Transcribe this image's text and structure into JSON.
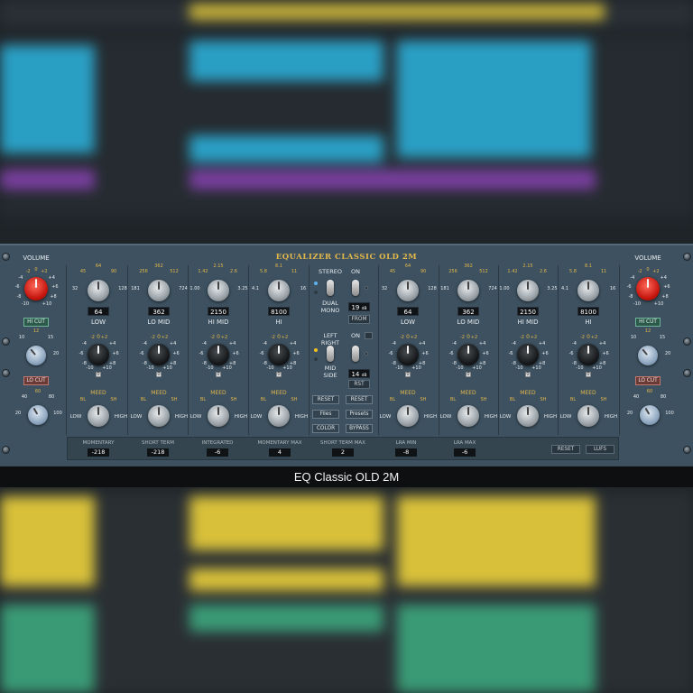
{
  "window": {
    "plugin_name": "EQUALIZER CLASSIC OLD 2M",
    "footer_title": "EQ Classic OLD 2M"
  },
  "channels": [
    {
      "volume_label": "VOLUME",
      "volume_ticks": [
        "-2",
        "0",
        "+2",
        "-4",
        "+4",
        "-6",
        "+6",
        "-8",
        "+8",
        "-10",
        "+10"
      ],
      "hicut_label": "HI CUT",
      "hicut_ticks": [
        "10",
        "12",
        "15",
        "20"
      ],
      "locut_label": "LO CUT",
      "locut_ticks": [
        "40",
        "60",
        "80",
        "20",
        "100"
      ],
      "bands": [
        {
          "label": "LOW",
          "freq": "64",
          "ticks": [
            "45",
            "64",
            "90",
            "32",
            "128"
          ],
          "meed_left": "BL",
          "meed_right": "SH"
        },
        {
          "label": "LO MID",
          "freq": "362",
          "ticks": [
            "256",
            "362",
            "512",
            "181",
            "724"
          ],
          "meed_left": "BL",
          "meed_right": "SH"
        },
        {
          "label": "HI MID",
          "freq": "2150",
          "ticks": [
            "1.42",
            "2.15",
            "2.6",
            "1.00",
            "3.25"
          ],
          "meed_left": "BL",
          "meed_right": "SH"
        },
        {
          "label": "HI",
          "freq": "8100",
          "ticks": [
            "5.8",
            "8.1",
            "11",
            "4.1",
            "16"
          ],
          "meed_left": "BL",
          "meed_right": "SH"
        }
      ]
    },
    {
      "volume_label": "VOLUME",
      "volume_ticks": [
        "-2",
        "0",
        "+2",
        "-4",
        "+4",
        "-6",
        "+6",
        "-8",
        "+8",
        "-10",
        "+10"
      ],
      "hicut_label": "HI CUT",
      "hicut_ticks": [
        "10",
        "12",
        "15",
        "20"
      ],
      "locut_label": "LO CUT",
      "locut_ticks": [
        "40",
        "60",
        "80",
        "20",
        "100"
      ],
      "bands": [
        {
          "label": "LOW",
          "freq": "64",
          "ticks": [
            "45",
            "64",
            "90",
            "32",
            "128"
          ],
          "meed_left": "BL",
          "meed_right": "SH"
        },
        {
          "label": "LO MID",
          "freq": "362",
          "ticks": [
            "256",
            "362",
            "512",
            "181",
            "724"
          ],
          "meed_left": "BL",
          "meed_right": "SH"
        },
        {
          "label": "HI MID",
          "freq": "2150",
          "ticks": [
            "1.42",
            "2.15",
            "2.6",
            "1.00",
            "3.25"
          ],
          "meed_left": "BL",
          "meed_right": "SH"
        },
        {
          "label": "HI",
          "freq": "8100",
          "ticks": [
            "5.8",
            "8.1",
            "11",
            "4.1",
            "16"
          ],
          "meed_left": "BL",
          "meed_right": "SH"
        }
      ]
    }
  ],
  "gain_ticks": [
    "-2",
    "0",
    "+2",
    "-4",
    "+4",
    "-6",
    "+6",
    "-8",
    "+8",
    "-10",
    "+10"
  ],
  "gain_led": "0",
  "meed_label": "MEED",
  "low_label": "LOW",
  "high_label": "HIGH",
  "center": {
    "stereo_label": "STEREO",
    "dual_mono_label": "DUAL\nMONO",
    "on_label": "ON",
    "display_top": "19",
    "display_top_unit": "dB",
    "from_label": "FROM",
    "left_right_label": "LEFT\nRIGHT",
    "mid_side_label": "MID\nSIDE",
    "display_bottom": "14",
    "display_bottom_unit": "dB",
    "rst_label": "RST",
    "buttons": {
      "reset_left": "RESET",
      "reset_right": "RESET",
      "files": "Files",
      "presets": "Presets",
      "color": "COLOR",
      "bypass": "BYPASS"
    }
  },
  "meters": [
    {
      "label": "MOMENTARY",
      "value": "-218"
    },
    {
      "label": "SHORT TERM",
      "value": "-218"
    },
    {
      "label": "INTEGRATED",
      "value": "-6"
    },
    {
      "label": "MOMENTARY MAX",
      "value": "4"
    },
    {
      "label": "SHORT TERM MAX",
      "value": "2"
    },
    {
      "label": "LRA MIN",
      "value": "-8"
    },
    {
      "label": "LRA MAX",
      "value": "-6"
    }
  ],
  "meter_buttons": {
    "reset": "RESET",
    "lufs": "LUFS"
  },
  "colors": {
    "accent": "#e3b84a",
    "panel": "#3d5160",
    "volume_knob": "#d51a10",
    "hicut_button": "#2c5a4a",
    "locut_button": "#6a3a36"
  }
}
